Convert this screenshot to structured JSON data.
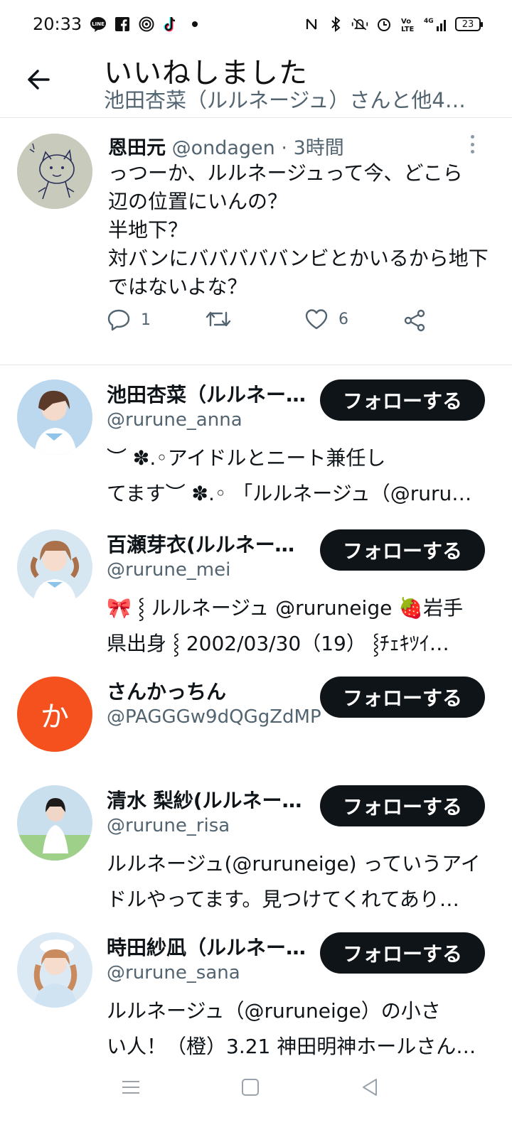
{
  "status_bar": {
    "time": "20:33",
    "left_icons": [
      "line-icon",
      "facebook-icon",
      "hotspot-icon",
      "tiktok-icon",
      "dot-icon"
    ],
    "right_icons": [
      "nfc-icon",
      "bluetooth-icon",
      "vibrate-mute-icon",
      "alarm-icon",
      "volte-icon",
      "signal-4g-icon"
    ],
    "battery": "23"
  },
  "header": {
    "title": "いいねしました",
    "subtitle": "池田杏菜（ルルネージュ）さんと他4…"
  },
  "tweet": {
    "name": "恩田元",
    "handle": "@ondagen",
    "separator": "·",
    "time": "3時間",
    "body_lines": [
      "っつーか、ルルネージュって今、どこら",
      "辺の位置にいんの？",
      "半地下？",
      "対バンにバババババンビとかいるから地下",
      "ではないよな？"
    ],
    "reply_count": "1",
    "retweet_count": "",
    "like_count": "6"
  },
  "users": [
    {
      "name": "池田杏菜（ルルネー…",
      "handle": "@rurune_anna",
      "bio_lines": [
        "︶ ✽.◦アイドルとニート兼任し",
        "てます︶ ✽.◦ 「ルルネージュ（@ruru…"
      ],
      "button": "フォローする",
      "avatar_color": "#bcd8ee"
    },
    {
      "name": "百瀬芽衣(ルルネージ…",
      "handle": "@rurune_mei",
      "bio_lines": [
        "🎀 ⸾ ルルネージュ @ruruneige 🍓岩手",
        "県出身 ⸾ 2002/03/30（19） ⸾ﾁｪｷﾂｲ…"
      ],
      "button": "フォローする",
      "avatar_color": "#d6e7f2"
    },
    {
      "name": "さんかっちん",
      "handle": "@PAGGGw9dQGgZdMP",
      "bio_lines": [],
      "button": "フォローする",
      "avatar_letter": "か",
      "avatar_color": "#f4511e"
    },
    {
      "name": "清水 梨紗(ルルネー…",
      "handle": "@rurune_risa",
      "bio_lines": [
        "ルルネージュ(@ruruneige) っていうアイ",
        "ドルやってます。見つけてくれてあり…"
      ],
      "button": "フォローする",
      "avatar_color": "#c9dfee"
    },
    {
      "name": "時田紗凪（ルルネー…",
      "handle": "@rurune_sana",
      "bio_lines": [
        "ルルネージュ（@ruruneige）の小さ",
        "い人！（橙）3.21 神田明神ホールさん…"
      ],
      "button": "フォローする",
      "avatar_color": "#dbe9f4"
    }
  ],
  "nav_bar": {
    "icons": [
      "menu-icon",
      "home-square-icon",
      "back-triangle-icon"
    ]
  }
}
